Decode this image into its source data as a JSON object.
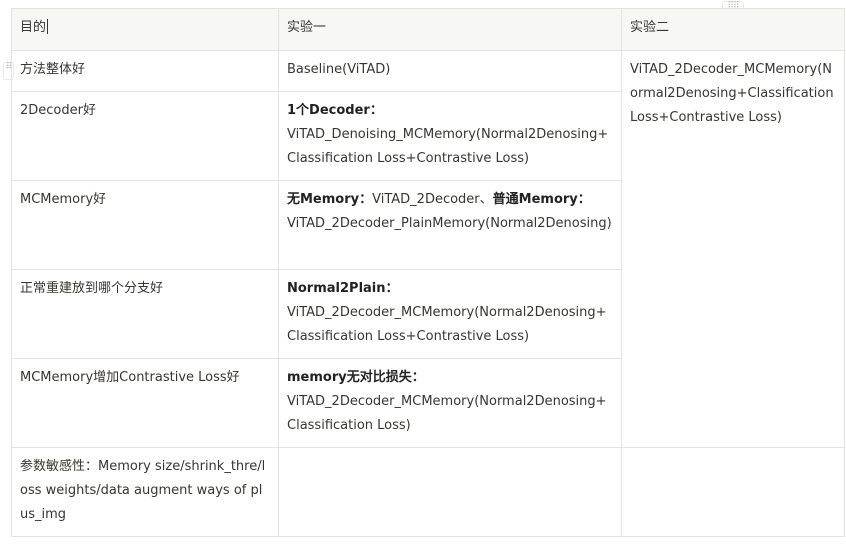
{
  "table": {
    "headers": [
      "目的",
      "实验一",
      "实验二"
    ],
    "rows": [
      {
        "purpose": "方法整体好",
        "exp1_lead": "",
        "exp1_body": "Baseline(ViTAD)"
      },
      {
        "purpose": "2Decoder好",
        "exp1_lead": "1个Decoder：",
        "exp1_body": "ViTAD_Denoising_MCMemory(Normal2Denosing+Classification Loss+Contrastive Loss)"
      },
      {
        "purpose": "MCMemory好",
        "exp1_lead": "无Memory：",
        "exp1_mid": "ViTAD_2Decoder、",
        "exp1_lead2": "普通Memory：",
        "exp1_body": "ViTAD_2Decoder_PlainMemory(Normal2Denosing)"
      },
      {
        "purpose": "正常重建放到哪个分支好",
        "exp1_lead": "Normal2Plain：",
        "exp1_body": "ViTAD_2Decoder_MCMemory(Normal2Denosing+Classification Loss+Contrastive Loss)"
      },
      {
        "purpose": "MCMemory增加Contrastive Loss好",
        "exp1_lead": "memory无对比损失：",
        "exp1_body": "ViTAD_2Decoder_MCMemory(Normal2Denosing+Classification Loss)"
      },
      {
        "purpose": "参数敏感性：Memory size/shrink_thre/loss weights/data augment ways of plus_img",
        "exp1_lead": "",
        "exp1_body": ""
      }
    ],
    "exp2_merged": "ViTAD_2Decoder_MCMemory(Normal2Denosing+Classification Loss+Contrastive Loss)"
  },
  "icons": [
    "drag-handle-icon",
    "column-handle-icon"
  ]
}
